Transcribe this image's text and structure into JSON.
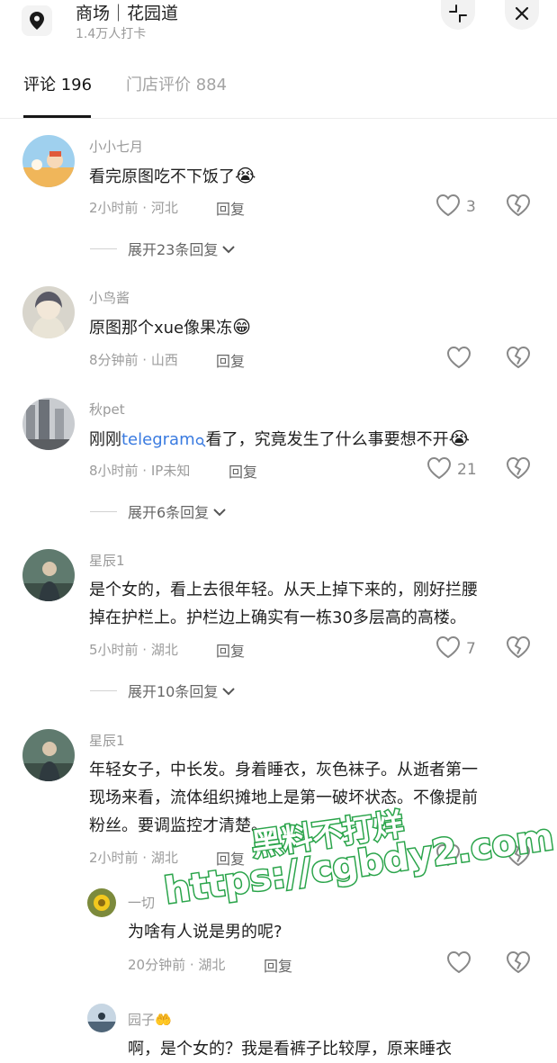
{
  "header": {
    "title": "商场｜花园道",
    "subtitle": "1.4万人打卡",
    "collapse_icon": "collapse-icon",
    "close_icon": "close-icon"
  },
  "tabs": [
    {
      "label": "评论 196",
      "active": true
    },
    {
      "label": "门店评价 884",
      "active": false
    }
  ],
  "labels": {
    "reply": "回复"
  },
  "comments": [
    {
      "user": "小小七月",
      "text": "看完原图吃不下饭了",
      "emoji": "😭",
      "time": "2小时前 · 河北",
      "likes": "3",
      "expand": "展开23条回复"
    },
    {
      "user": "小鸟酱",
      "text": "原图那个xue像果冻",
      "emoji": "😁",
      "time": "8分钟前 · 山西",
      "likes": "",
      "expand": ""
    },
    {
      "user": "秋pet",
      "text_prefix": "刚刚",
      "link": "telegram",
      "text_suffix": "看了，究竟发生了什么事要想不开",
      "emoji": "😭",
      "time": "8小时前 · IP未知",
      "likes": "21",
      "expand": "展开6条回复"
    },
    {
      "user": "星辰1",
      "lines": [
        "是个女的，看上去很年轻。从天上掉下来的，刚好拦腰",
        "掉在护栏上。护栏边上确实有一栋30多层高的高楼。"
      ],
      "time": "5小时前 · 湖北",
      "likes": "7",
      "expand": "展开10条回复"
    },
    {
      "user": "星辰1",
      "lines": [
        "年轻女子，中长发。身着睡衣，灰色袜子。从逝者第一",
        "现场来看，流体组织摊地上是第一破坏状态。不像提前",
        "粉丝。要调监控才清楚。"
      ],
      "time": "2小时前 · 湖北",
      "likes": "",
      "expand": ""
    }
  ],
  "replies": [
    {
      "user": "一切",
      "text": "为啥有人说是男的呢?",
      "time": "20分钟前 · 湖北",
      "likes": ""
    },
    {
      "user": "园子",
      "user_emoji": "🤲",
      "text": "啊，是个女的？我是看裤子比较厚，原来睡衣",
      "time": "",
      "likes": ""
    }
  ],
  "watermark": {
    "line1": "黑料不打烊",
    "line2": "https://cgbdy2.com"
  },
  "colors": {
    "link": "#3a7be0",
    "watermark_stroke": "#2aa44a"
  }
}
